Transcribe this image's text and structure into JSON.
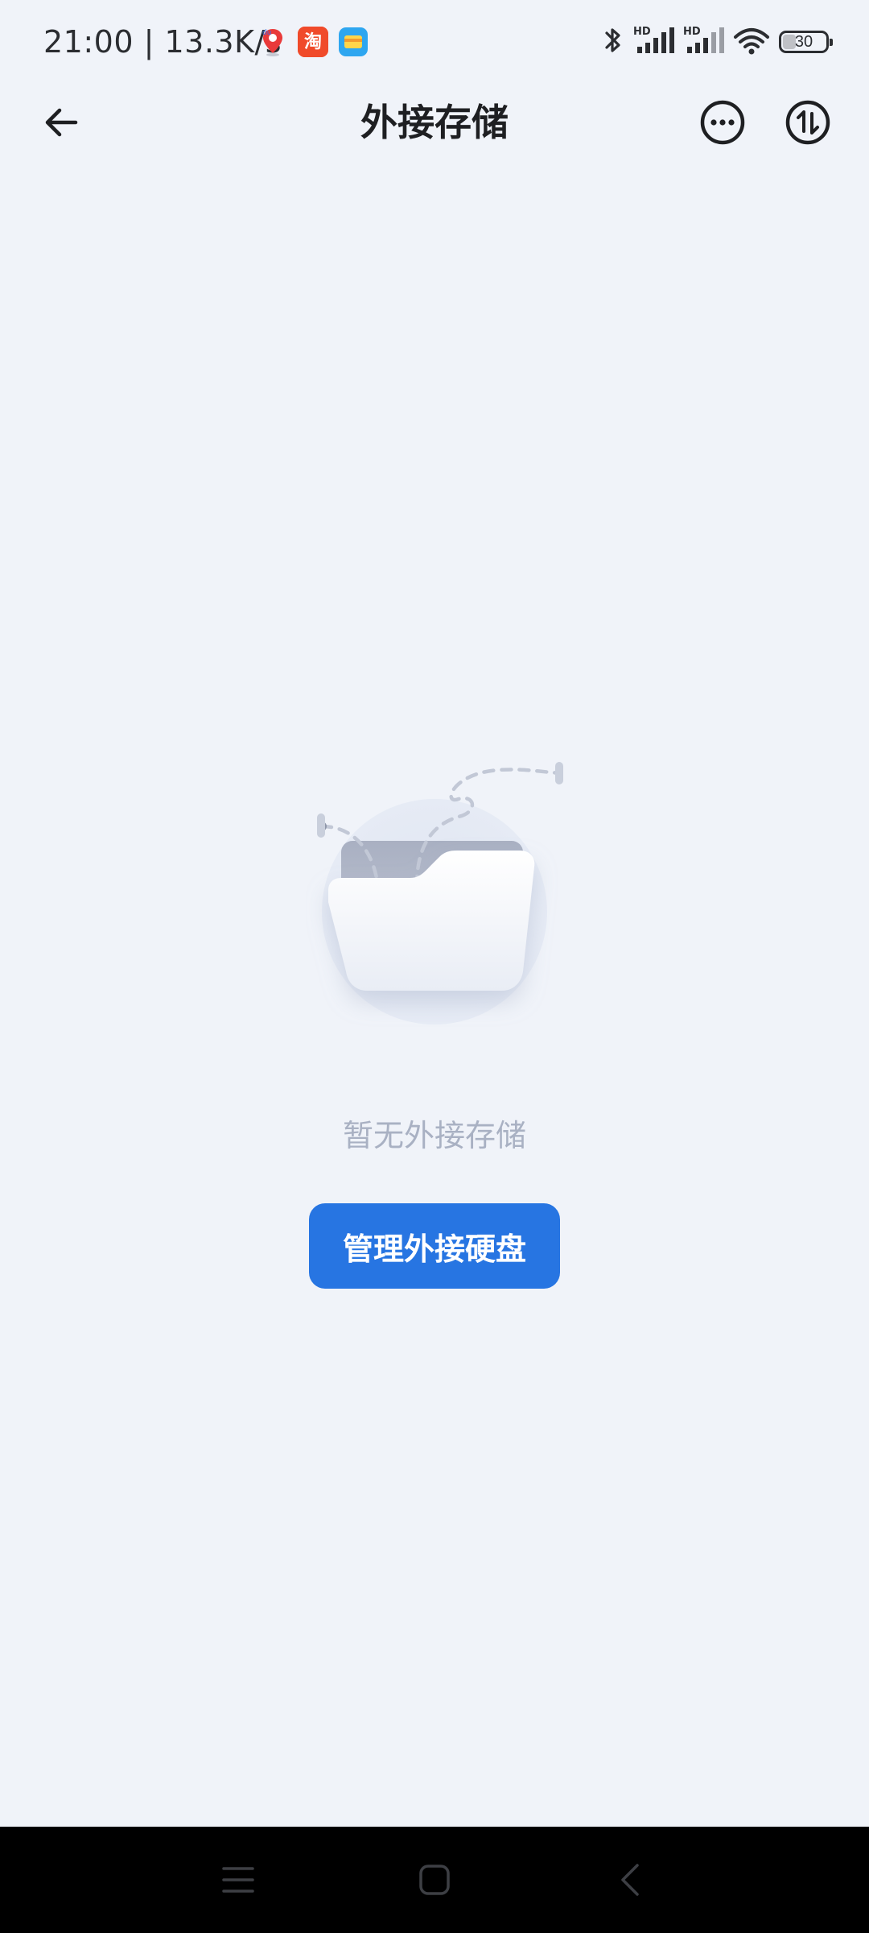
{
  "status_bar": {
    "time": "21:00 | 13.3K/s",
    "battery_level": "30",
    "battery_fraction": 0.3,
    "app_icons": [
      "baidu-maps-icon",
      "taobao-icon",
      "wallet-app-icon"
    ],
    "system_icons": [
      "bluetooth-icon",
      "signal-hd-1-icon",
      "signal-hd-2-icon",
      "wifi-icon",
      "battery-icon"
    ]
  },
  "header": {
    "title": "外接存储",
    "back_icon": "arrow-left-icon",
    "more_icon": "more-circle-icon",
    "transfer_icon": "transfer-arrows-icon"
  },
  "empty_state": {
    "illustration": "empty-folder-illustration",
    "message": "暂无外接存储",
    "button_label": "管理外接硬盘"
  },
  "colors": {
    "background": "#f0f3f9",
    "primary": "#2775e2",
    "empty_text": "#a9b1c3",
    "title_text": "#1e1f22",
    "nav_bar": "#000000"
  },
  "nav_bar": {
    "items": [
      "menu-icon",
      "home-icon",
      "back-icon"
    ]
  }
}
